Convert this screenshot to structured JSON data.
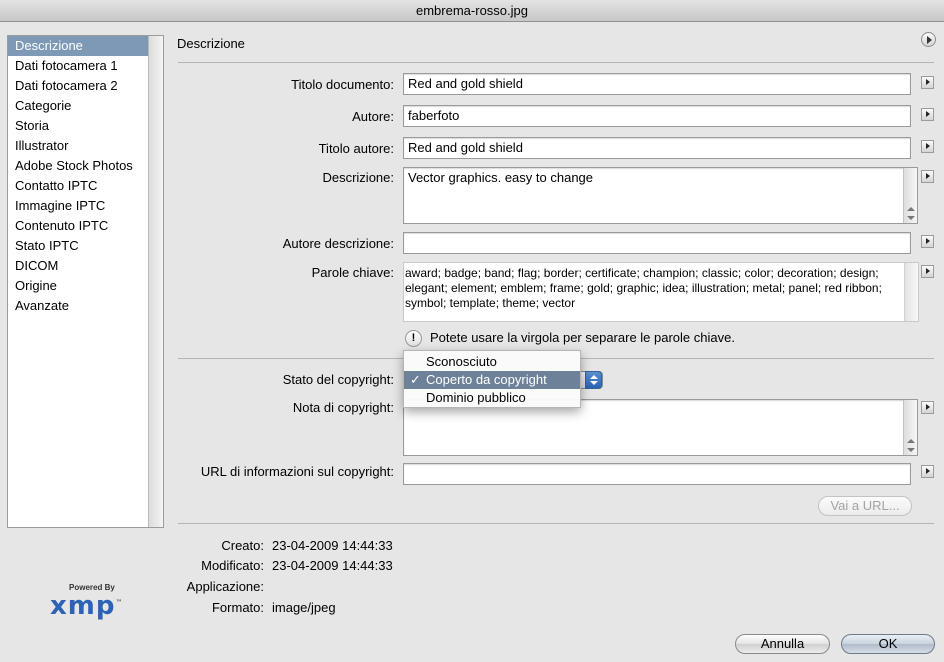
{
  "window": {
    "title": "embrema-rosso.jpg"
  },
  "sidebar": {
    "items": [
      {
        "label": "Descrizione",
        "selected": true
      },
      {
        "label": "Dati fotocamera 1"
      },
      {
        "label": "Dati fotocamera 2"
      },
      {
        "label": "Categorie"
      },
      {
        "label": "Storia"
      },
      {
        "label": "Illustrator"
      },
      {
        "label": "Adobe Stock Photos"
      },
      {
        "label": "Contatto IPTC"
      },
      {
        "label": "Immagine IPTC"
      },
      {
        "label": "Contenuto IPTC"
      },
      {
        "label": "Stato IPTC"
      },
      {
        "label": "DICOM"
      },
      {
        "label": "Origine"
      },
      {
        "label": "Avanzate"
      }
    ]
  },
  "main": {
    "section_title": "Descrizione",
    "fields": {
      "document_title": {
        "label": "Titolo documento:",
        "value": "Red and gold shield"
      },
      "author": {
        "label": "Autore:",
        "value": "faberfoto"
      },
      "author_title": {
        "label": "Titolo autore:",
        "value": "Red and gold shield"
      },
      "description": {
        "label": "Descrizione:",
        "value": "Vector graphics. easy to change"
      },
      "description_author": {
        "label": "Autore descrizione:",
        "value": ""
      },
      "keywords": {
        "label": "Parole chiave:",
        "value": "award; badge; band; flag; border; certificate; champion; classic; color; decoration; design; elegant; element; emblem; frame; gold; graphic; idea; illustration; metal; panel; red ribbon; symbol; template; theme; vector"
      }
    },
    "keywords_hint": "Potete usare la virgola per separare le parole chiave.",
    "hint_icon_glyph": "!",
    "copyright": {
      "status_label": "Stato del copyright:",
      "options": [
        "Sconosciuto",
        "Coperto da copyright",
        "Dominio pubblico"
      ],
      "selected": "Coperto da copyright",
      "check_glyph": "✓",
      "notice_label": "Nota di copyright:",
      "notice_value": "",
      "url_label": "URL di informazioni sul copyright:",
      "url_value": "",
      "goto_url_button": "Vai a URL..."
    },
    "info": {
      "created_label": "Creato:",
      "created": "23-04-2009 14:44:33",
      "modified_label": "Modificato:",
      "modified": "23-04-2009 14:44:33",
      "application_label": "Applicazione:",
      "application": "",
      "format_label": "Formato:",
      "format": "image/jpeg"
    }
  },
  "logo": {
    "powered": "Powered By",
    "name": "xmp",
    "tm": "™"
  },
  "buttons": {
    "cancel": "Annulla",
    "ok": "OK"
  }
}
